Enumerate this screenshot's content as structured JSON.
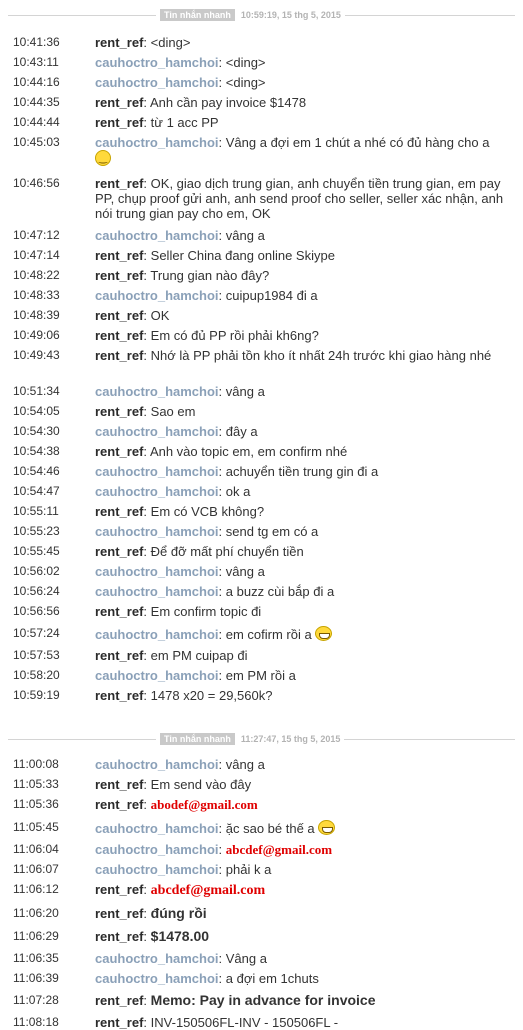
{
  "sessions": [
    {
      "tag": "Tin nhắn nhanh",
      "time": "10:59:19, 15 thg 5, 2015",
      "messages": [
        {
          "t": "10:41:36",
          "u": "rent_ref",
          "text": "<ding>"
        },
        {
          "t": "10:43:11",
          "u": "cauhoctro_hamchoi",
          "text": "<ding>"
        },
        {
          "t": "10:44:16",
          "u": "cauhoctro_hamchoi",
          "text": "<ding>"
        },
        {
          "t": "10:44:35",
          "u": "rent_ref",
          "text": "Anh cần pay invoice $1478"
        },
        {
          "t": "10:44:44",
          "u": "rent_ref",
          "text": "từ 1 acc PP"
        },
        {
          "t": "10:45:03",
          "u": "cauhoctro_hamchoi",
          "text": "Vâng a đợi em 1 chút a nhé có đủ hàng cho a",
          "emoji": "smiley"
        },
        {
          "t": "10:46:56",
          "u": "rent_ref",
          "text": "OK, giao dịch trung gian, anh chuyển tiền trung gian, em pay PP, chụp proof gửi anh, anh send proof cho seller, seller xác nhận, anh nói trung gian pay cho em, OK"
        },
        {
          "t": "10:47:12",
          "u": "cauhoctro_hamchoi",
          "text": "vâng a"
        },
        {
          "t": "10:47:14",
          "u": "rent_ref",
          "text": "Seller China đang online Skiype"
        },
        {
          "t": "10:48:22",
          "u": "rent_ref",
          "text": "Trung gian nào đây?"
        },
        {
          "t": "10:48:33",
          "u": "cauhoctro_hamchoi",
          "text": "cuipup1984 đi a"
        },
        {
          "t": "10:48:39",
          "u": "rent_ref",
          "text": "OK"
        },
        {
          "t": "10:49:06",
          "u": "rent_ref",
          "text": "Em có đủ PP rồi phải kh6ng?"
        },
        {
          "t": "10:49:43",
          "u": "rent_ref",
          "text": "Nhớ là PP phải tồn kho ít nhất 24h trước khi giao hàng nhé"
        },
        {
          "t": "10:51:34",
          "u": "cauhoctro_hamchoi",
          "text": "vâng a"
        },
        {
          "t": "10:54:05",
          "u": "rent_ref",
          "text": "Sao em"
        },
        {
          "t": "10:54:30",
          "u": "cauhoctro_hamchoi",
          "text": "đây a"
        },
        {
          "t": "10:54:38",
          "u": "rent_ref",
          "text": "Anh vào topic em, em confirm nhé"
        },
        {
          "t": "10:54:46",
          "u": "cauhoctro_hamchoi",
          "text": "achuyển tiền trung gin đi a"
        },
        {
          "t": "10:54:47",
          "u": "cauhoctro_hamchoi",
          "text": "ok a"
        },
        {
          "t": "10:55:11",
          "u": "rent_ref",
          "text": "Em có VCB không?"
        },
        {
          "t": "10:55:23",
          "u": "cauhoctro_hamchoi",
          "text": "send tg em có a"
        },
        {
          "t": "10:55:45",
          "u": "rent_ref",
          "text": "Để đỡ mất phí chuyển tiền"
        },
        {
          "t": "10:56:02",
          "u": "cauhoctro_hamchoi",
          "text": "vâng a"
        },
        {
          "t": "10:56:24",
          "u": "cauhoctro_hamchoi",
          "text": "a buzz cùi bắp đi a"
        },
        {
          "t": "10:56:56",
          "u": "rent_ref",
          "text": "Em confirm topic đi"
        },
        {
          "t": "10:57:24",
          "u": "cauhoctro_hamchoi",
          "text": "em cofirm rồi a",
          "emoji": "grin"
        },
        {
          "t": "10:57:53",
          "u": "rent_ref",
          "text": "em PM cuipap đi"
        },
        {
          "t": "10:58:20",
          "u": "cauhoctro_hamchoi",
          "text": "em PM rồi a"
        },
        {
          "t": "10:59:19",
          "u": "rent_ref",
          "text": "1478 x20 = 29,560k?"
        }
      ]
    },
    {
      "tag": "Tin nhắn nhanh",
      "time": "11:27:47, 15 thg 5, 2015",
      "messages": [
        {
          "t": "11:00:08",
          "u": "cauhoctro_hamchoi",
          "text": "vâng a"
        },
        {
          "t": "11:05:33",
          "u": "rent_ref",
          "text": "Em send vào đây"
        },
        {
          "t": "11:05:36",
          "u": "rent_ref",
          "text": "abodef@gmail.com",
          "red": true
        },
        {
          "t": "11:05:45",
          "u": "cauhoctro_hamchoi",
          "text": "ặc sao bé thế a",
          "emoji": "grin"
        },
        {
          "t": "11:06:04",
          "u": "cauhoctro_hamchoi",
          "text": "abcdef@gmail.com",
          "red": true
        },
        {
          "t": "11:06:07",
          "u": "cauhoctro_hamchoi",
          "text": "phải k a"
        },
        {
          "t": "11:06:12",
          "u": "rent_ref",
          "text": "abcdef@gmail.com",
          "big": true,
          "red": true
        },
        {
          "t": "11:06:20",
          "u": "rent_ref",
          "text": "đúng rồi",
          "big": true
        },
        {
          "t": "11:06:29",
          "u": "rent_ref",
          "text": "$1478.00",
          "big": true
        },
        {
          "t": "11:06:35",
          "u": "cauhoctro_hamchoi",
          "text": "Vâng a"
        },
        {
          "t": "11:06:39",
          "u": "cauhoctro_hamchoi",
          "text": "a đợi em 1chuts"
        },
        {
          "t": "11:07:28",
          "u": "rent_ref",
          "text": "Memo: Pay in advance for invoice",
          "big": true
        },
        {
          "t": "11:08:18",
          "u": "rent_ref",
          "text": "INV-150506FL-INV - 150506FL -"
        }
      ]
    }
  ],
  "colors": {
    "rent_ref": "#2b2b2b",
    "cauhoctro_hamchoi": "#8aa0b8",
    "redaction": "#e00000"
  }
}
